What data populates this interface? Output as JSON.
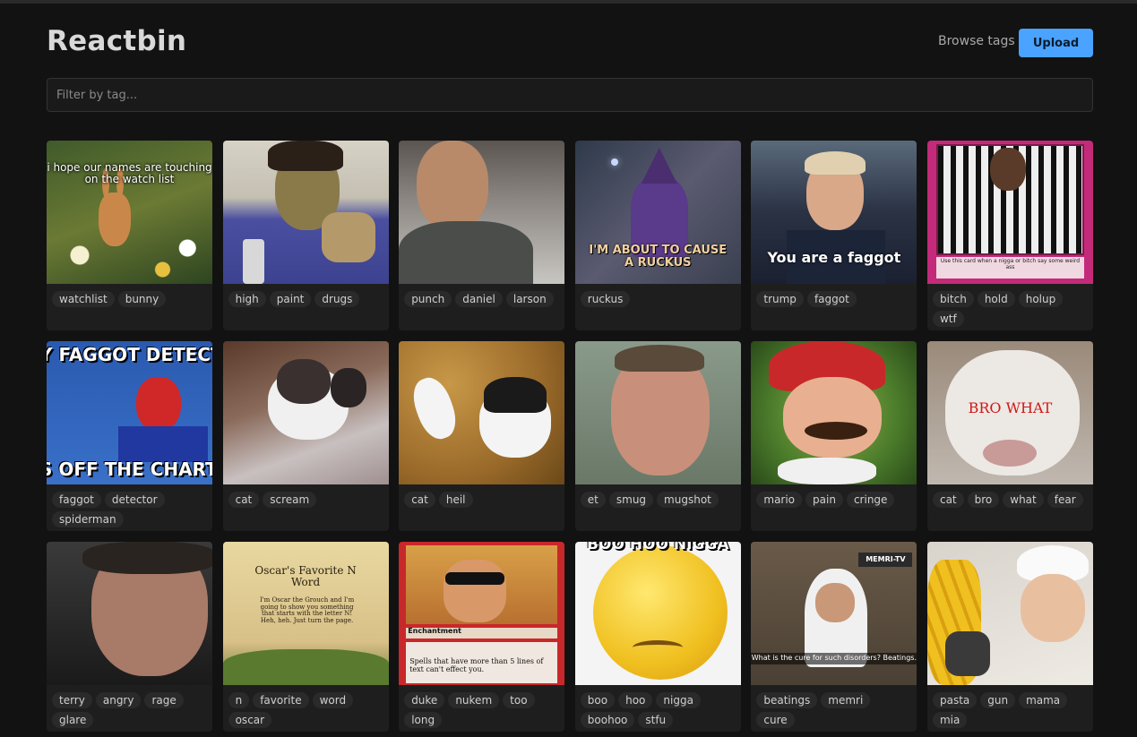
{
  "header": {
    "title": "Reactbin",
    "browse_label": "Browse tags",
    "upload_label": "Upload"
  },
  "filter": {
    "placeholder": "Filter by tag..."
  },
  "cards": [
    {
      "caption": "i hope our names are touching on the watch list",
      "tags": [
        "watchlist",
        "bunny"
      ]
    },
    {
      "caption": "",
      "tags": [
        "high",
        "paint",
        "drugs"
      ]
    },
    {
      "caption": "",
      "tags": [
        "punch",
        "daniel",
        "larson"
      ]
    },
    {
      "caption": "I'M ABOUT TO CAUSE A RUCKUS",
      "tags": [
        "ruckus"
      ]
    },
    {
      "caption": "You are a faggot",
      "tags": [
        "trump",
        "faggot"
      ]
    },
    {
      "caption": "Use this card when a nigga or bitch say some weird ass",
      "tags": [
        "bitch",
        "hold",
        "holup",
        "wtf"
      ]
    },
    {
      "caption": "Y FAGGOT DETECTO",
      "caption2": "S OFF THE CHARTS",
      "tags": [
        "faggot",
        "detector",
        "spiderman"
      ]
    },
    {
      "caption": "",
      "tags": [
        "cat",
        "scream"
      ]
    },
    {
      "caption": "",
      "tags": [
        "cat",
        "heil"
      ]
    },
    {
      "caption": "",
      "tags": [
        "et",
        "smug",
        "mugshot"
      ]
    },
    {
      "caption": "",
      "tags": [
        "mario",
        "pain",
        "cringe"
      ]
    },
    {
      "caption": "BRO WHAT",
      "tags": [
        "cat",
        "bro",
        "what",
        "fear"
      ]
    },
    {
      "caption": "",
      "tags": [
        "terry",
        "angry",
        "rage",
        "glare"
      ]
    },
    {
      "caption": "Oscar's Favorite N Word",
      "caption2": "I'm Oscar the Grouch and I'm going to show you something that starts with the letter N! Heh, heh. Just turn the page.",
      "tags": [
        "n",
        "favorite",
        "word",
        "oscar"
      ]
    },
    {
      "caption": "Enchantment",
      "caption2": "Spells that have more than 5 lines of text can't effect you.",
      "tags": [
        "duke",
        "nukem",
        "too",
        "long"
      ]
    },
    {
      "caption": "BOO HOO NIGGA",
      "tags": [
        "boo",
        "hoo",
        "nigga",
        "boohoo",
        "stfu"
      ]
    },
    {
      "caption": "What is the cure for such disorders? Beatings.",
      "caption2": "MEMRI-TV",
      "tags": [
        "beatings",
        "memri",
        "cure"
      ]
    },
    {
      "caption": "",
      "tags": [
        "pasta",
        "gun",
        "mama",
        "mia"
      ]
    }
  ]
}
